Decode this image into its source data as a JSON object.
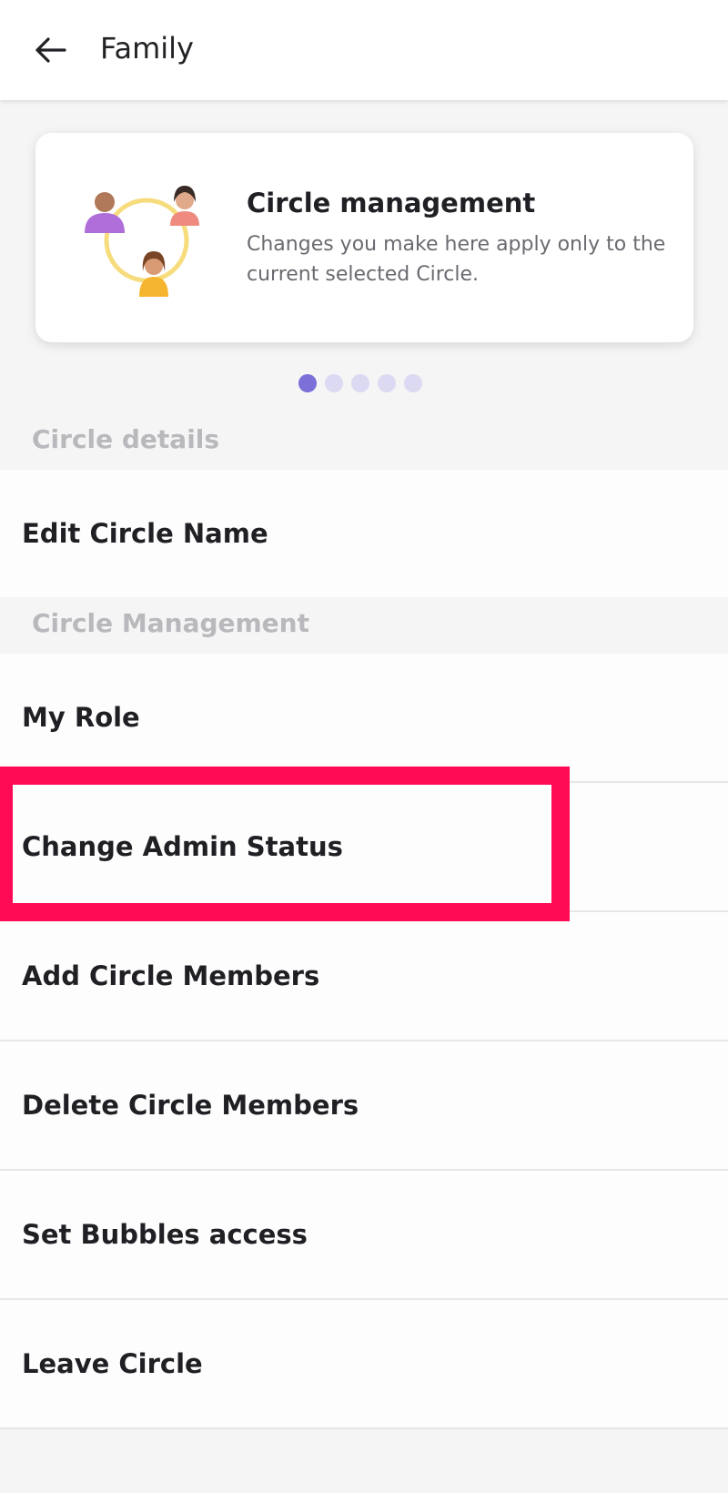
{
  "appbar": {
    "title": "Family",
    "back_icon": "arrow-left-icon"
  },
  "card": {
    "title": "Circle management",
    "description": "Changes you make here apply only to the current selected Circle.",
    "illustration": "circle-members-illustration"
  },
  "pager": {
    "count": 5,
    "active_index": 0
  },
  "sections": {
    "details": {
      "header": "Circle details",
      "items": [
        "Edit Circle Name"
      ]
    },
    "management": {
      "header": "Circle Management",
      "items": [
        "My Role",
        "Change Admin Status",
        "Add Circle Members",
        "Delete Circle Members",
        "Set Bubbles access",
        "Leave Circle"
      ]
    }
  },
  "colors": {
    "accent": "#7a70d8",
    "highlight": "#ff0a54",
    "section_header": "#b9b9bd"
  }
}
